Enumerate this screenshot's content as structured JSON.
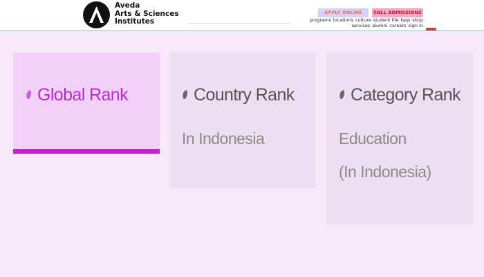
{
  "brand": {
    "line1": "Aveda",
    "line2": "Arts & Sciences",
    "line3": "Institutes",
    "logo_icon": "aveda-a-logo-icon"
  },
  "cta": {
    "apply": "APPLY ONLINE",
    "call": "CALL ADMISSIONS"
  },
  "nav": {
    "programs": "programs",
    "locations": "locations",
    "culture": "culture",
    "student_life": "student life",
    "faqs": "faqs",
    "shop": "shop",
    "services": "services",
    "alumni": "alumni",
    "careers": "careers",
    "sign_in": "sign in"
  },
  "ranks": {
    "global": {
      "title": "Global Rank"
    },
    "country": {
      "title": "Country Rank",
      "subtitle": "In Indonesia"
    },
    "category": {
      "title": "Category Rank",
      "subtitle_line1": "Education",
      "subtitle_line2": "(In Indonesia)"
    }
  },
  "colors": {
    "page_bg": "#f6e8f8",
    "active_card_bg": "#f3d0f8",
    "active_accent": "#c61fd1",
    "apply_bg": "#ddd0f6",
    "apply_text": "#e8743a",
    "call_bg": "#f5a7c6",
    "call_text": "#c0141c"
  }
}
